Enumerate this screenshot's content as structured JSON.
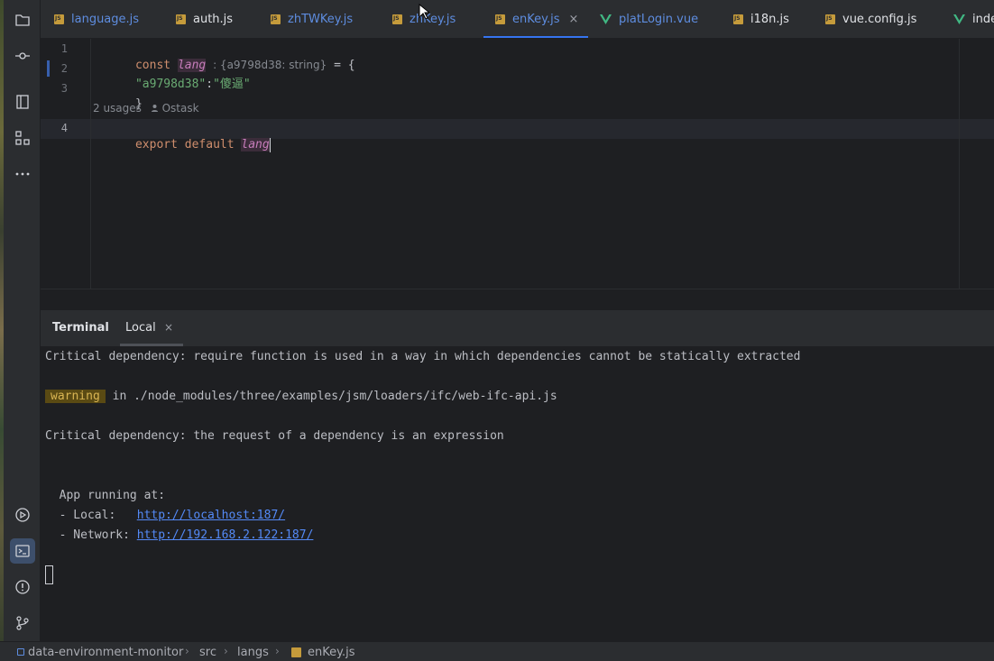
{
  "tabs": [
    {
      "label": "language.js",
      "type": "js",
      "modified": true
    },
    {
      "label": "auth.js",
      "type": "js",
      "modified": false
    },
    {
      "label": "zhTWKey.js",
      "type": "js",
      "modified": true
    },
    {
      "label": "zhKey.js",
      "type": "js",
      "modified": true
    },
    {
      "label": "enKey.js",
      "type": "js",
      "modified": true,
      "active": true
    },
    {
      "label": "platLogin.vue",
      "type": "vue",
      "modified": true
    },
    {
      "label": "i18n.js",
      "type": "js",
      "modified": false
    },
    {
      "label": "vue.config.js",
      "type": "js",
      "modified": false
    },
    {
      "label": "inde",
      "type": "vue",
      "modified": false
    }
  ],
  "editor": {
    "line_numbers": [
      "1",
      "2",
      "3",
      "4"
    ],
    "line1": {
      "kw": "const",
      "var": "lang",
      "hint": ": {a9798d38: string}",
      "rest": " = {"
    },
    "line2": {
      "key": "\"a9798d38\"",
      "colon": ":",
      "value": "\"傻逼\""
    },
    "line3": "}",
    "usages": "2 usages",
    "author": "Ostask",
    "line4": {
      "kw1": "export",
      "kw2": "default",
      "var": "lang"
    }
  },
  "terminal": {
    "title": "Terminal",
    "tab_label": "Local",
    "close_glyph": "×",
    "lines": {
      "dep1": "Critical dependency: require function is used in a way in which dependencies cannot be statically extracted",
      "warn_badge": "warning",
      "warn_text": " in ./node_modules/three/examples/jsm/loaders/ifc/web-ifc-api.js",
      "dep2": "Critical dependency: the request of a dependency is an expression",
      "app_running": "  App running at:",
      "local_label": "  - Local:   ",
      "local_url": "http://localhost:187/",
      "network_label": "  - Network: ",
      "network_url": "http://192.168.2.122:187/"
    }
  },
  "status_bar": {
    "breadcrumbs": [
      "data-environment-monitor",
      "src",
      "langs",
      "enKey.js"
    ],
    "separator": "›"
  },
  "colors": {
    "accent": "#3574f0",
    "keyword": "#cf8e6d",
    "string": "#6aab73",
    "variable": "#c77dbb",
    "link": "#548af7",
    "warning": "#d9b553"
  }
}
